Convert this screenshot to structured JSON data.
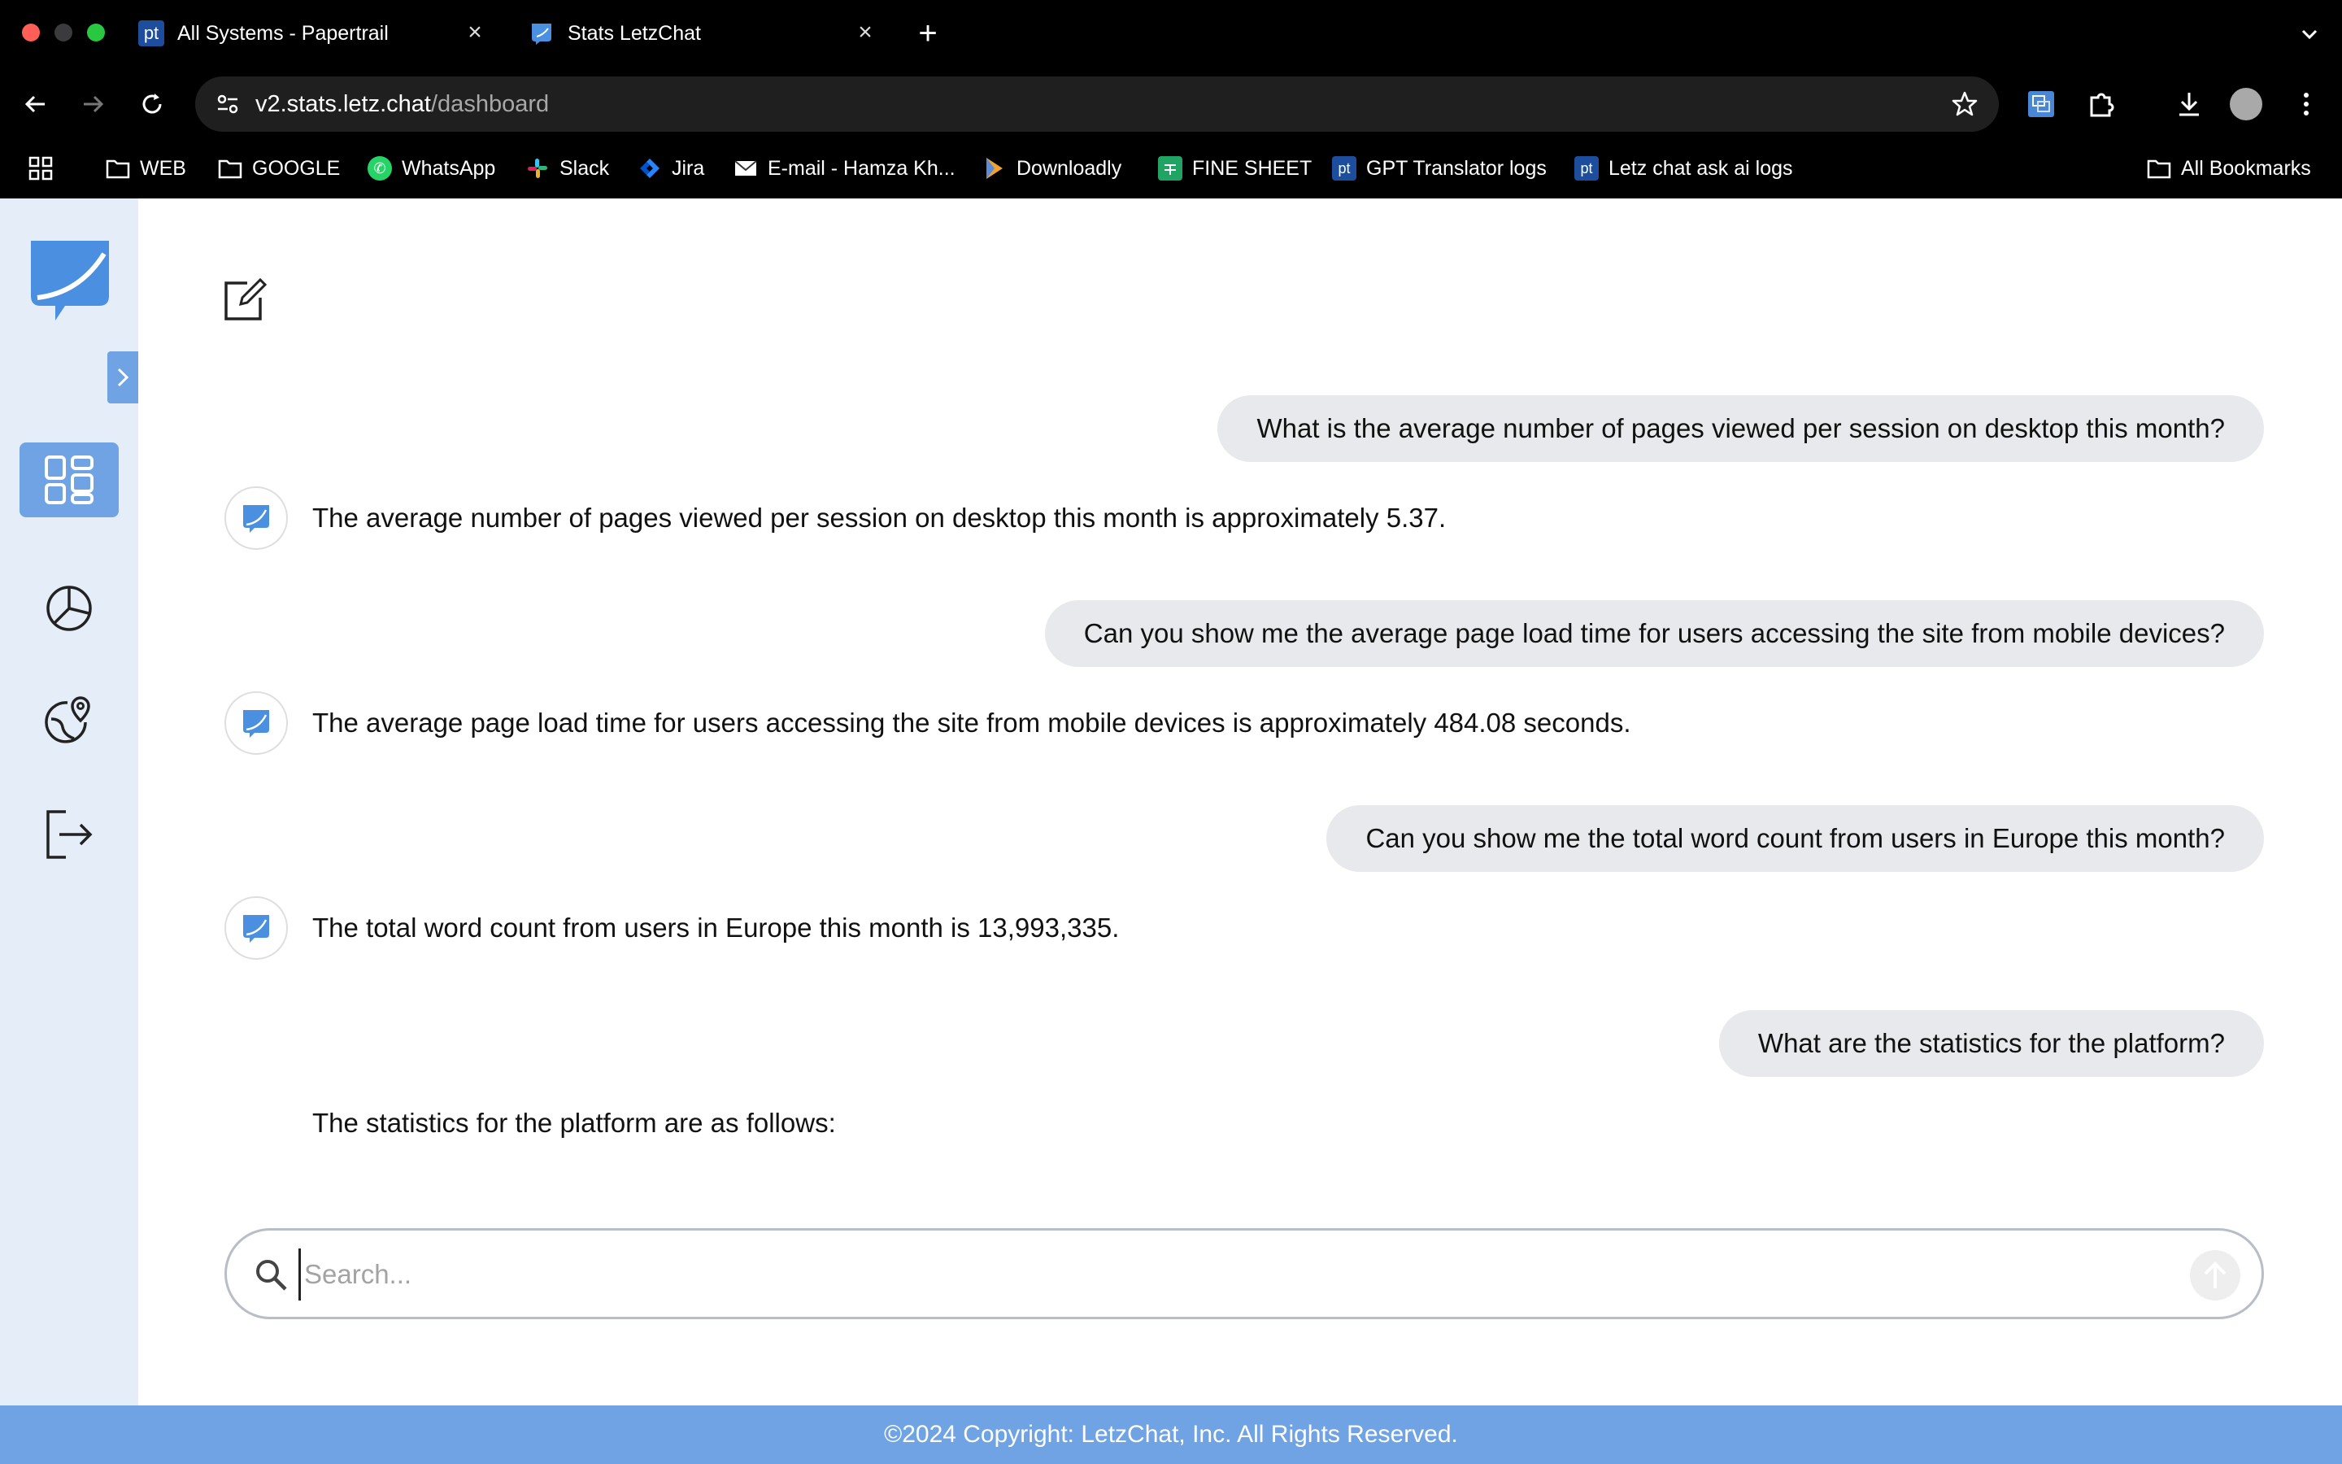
{
  "browser": {
    "tabs": [
      {
        "favicon": "pt",
        "title": "All Systems - Papertrail"
      },
      {
        "favicon": "letzchat-logo-icon",
        "title": "Stats LetzChat"
      }
    ],
    "url_host": "v2.stats.letz.chat",
    "url_path": "/dashboard",
    "bookmarks": [
      {
        "label": "WEB",
        "icon": "folder-icon"
      },
      {
        "label": "GOOGLE",
        "icon": "folder-icon"
      },
      {
        "label": "WhatsApp",
        "icon": "whatsapp-icon"
      },
      {
        "label": "Slack",
        "icon": "slack-icon"
      },
      {
        "label": "Jira",
        "icon": "jira-icon"
      },
      {
        "label": "E-mail - Hamza Kh...",
        "icon": "mail-icon"
      },
      {
        "label": "Downloadly",
        "icon": "downloadly-icon"
      },
      {
        "label": "FINE SHEET",
        "icon": "sheets-icon"
      },
      {
        "label": "GPT Translator logs",
        "icon": "pt"
      },
      {
        "label": "Letz chat ask ai logs",
        "icon": "pt"
      }
    ],
    "all_bookmarks": "All Bookmarks",
    "colors": {
      "chrome_bg": "#000000",
      "omnibox_bg": "#1f1f1f",
      "pt_blue": "#1d4e9e"
    }
  },
  "app": {
    "sidebar": {
      "nav": [
        {
          "name": "dashboard",
          "icon": "dashboard-grid-icon",
          "active": true
        },
        {
          "name": "analytics",
          "icon": "pie-chart-icon",
          "active": false
        },
        {
          "name": "location",
          "icon": "globe-location-icon",
          "active": false
        },
        {
          "name": "logout",
          "icon": "logout-icon",
          "active": false
        }
      ]
    },
    "chat": [
      {
        "role": "user",
        "text": "What is the average number of pages viewed per session on desktop this month?"
      },
      {
        "role": "bot",
        "text": "The average number of pages viewed per session on desktop this month is approximately 5.37."
      },
      {
        "role": "user",
        "text": "Can you show me the average page load time for users accessing the site from mobile devices?"
      },
      {
        "role": "bot",
        "text": "The average page load time for users accessing the site from mobile devices is approximately 484.08 seconds."
      },
      {
        "role": "user",
        "text": "Can you show me the total word count from users in Europe this month?"
      },
      {
        "role": "bot",
        "text": "The total word count from users in Europe this month is 13,993,335."
      },
      {
        "role": "user",
        "text": "What are the statistics for the platform?"
      },
      {
        "role": "bot",
        "text": "The statistics for the platform are as follows:"
      }
    ],
    "search": {
      "placeholder": "Search...",
      "value": ""
    },
    "footer": "©2024 Copyright: LetzChat, Inc. All Rights Reserved.",
    "colors": {
      "accent": "#6fa3e3",
      "sidebar_bg": "#e5eef8",
      "bubble_bg": "#e8e9ec"
    }
  }
}
